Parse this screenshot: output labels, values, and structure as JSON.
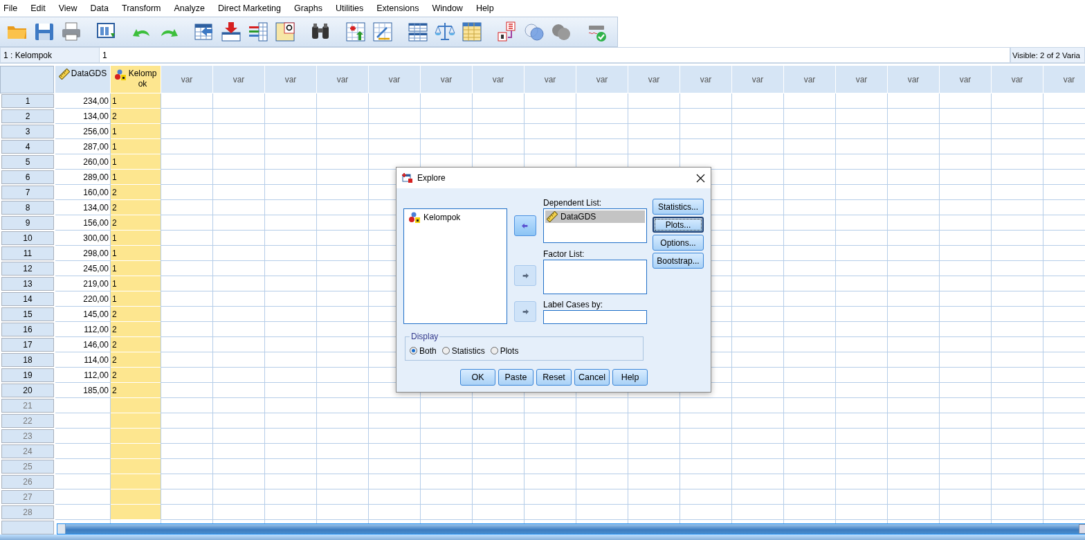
{
  "menu": [
    {
      "label": "File"
    },
    {
      "label": "Edit"
    },
    {
      "label": "View"
    },
    {
      "label": "Data"
    },
    {
      "label": "Transform"
    },
    {
      "label": "Analyze"
    },
    {
      "label": "Direct Marketing"
    },
    {
      "label": "Graphs"
    },
    {
      "label": "Utilities"
    },
    {
      "label": "Extensions"
    },
    {
      "label": "Window"
    },
    {
      "label": "Help"
    }
  ],
  "cell_editor": {
    "cell": "1 : Kelompok",
    "value": "1",
    "visible": "Visible: 2 of 2 Varia"
  },
  "grid": {
    "columns": [
      {
        "label": "DataGDS",
        "kind": "scale",
        "selected": false
      },
      {
        "label": "Kelompok",
        "kind": "nominal",
        "selected": true
      },
      {
        "label": "var",
        "kind": "empty",
        "selected": false
      },
      {
        "label": "var",
        "kind": "empty",
        "selected": false
      },
      {
        "label": "var",
        "kind": "empty",
        "selected": false
      },
      {
        "label": "var",
        "kind": "empty",
        "selected": false
      },
      {
        "label": "var",
        "kind": "empty",
        "selected": false
      },
      {
        "label": "var",
        "kind": "empty",
        "selected": false
      },
      {
        "label": "var",
        "kind": "empty",
        "selected": false
      },
      {
        "label": "var",
        "kind": "empty",
        "selected": false
      },
      {
        "label": "var",
        "kind": "empty",
        "selected": false
      },
      {
        "label": "var",
        "kind": "empty",
        "selected": false
      },
      {
        "label": "var",
        "kind": "empty",
        "selected": false
      },
      {
        "label": "var",
        "kind": "empty",
        "selected": false
      },
      {
        "label": "var",
        "kind": "empty",
        "selected": false
      },
      {
        "label": "var",
        "kind": "empty",
        "selected": false
      },
      {
        "label": "var",
        "kind": "empty",
        "selected": false
      },
      {
        "label": "var",
        "kind": "empty",
        "selected": false
      },
      {
        "label": "var",
        "kind": "empty",
        "selected": false
      },
      {
        "label": "var",
        "kind": "empty",
        "selected": false
      }
    ],
    "rows": [
      {
        "number": "1",
        "filled": true,
        "cells": [
          "234,00",
          "1"
        ]
      },
      {
        "number": "2",
        "filled": true,
        "cells": [
          "134,00",
          "2"
        ]
      },
      {
        "number": "3",
        "filled": true,
        "cells": [
          "256,00",
          "1"
        ]
      },
      {
        "number": "4",
        "filled": true,
        "cells": [
          "287,00",
          "1"
        ]
      },
      {
        "number": "5",
        "filled": true,
        "cells": [
          "260,00",
          "1"
        ]
      },
      {
        "number": "6",
        "filled": true,
        "cells": [
          "289,00",
          "1"
        ]
      },
      {
        "number": "7",
        "filled": true,
        "cells": [
          "160,00",
          "2"
        ]
      },
      {
        "number": "8",
        "filled": true,
        "cells": [
          "134,00",
          "2"
        ]
      },
      {
        "number": "9",
        "filled": true,
        "cells": [
          "156,00",
          "2"
        ]
      },
      {
        "number": "10",
        "filled": true,
        "cells": [
          "300,00",
          "1"
        ]
      },
      {
        "number": "11",
        "filled": true,
        "cells": [
          "298,00",
          "1"
        ]
      },
      {
        "number": "12",
        "filled": true,
        "cells": [
          "245,00",
          "1"
        ]
      },
      {
        "number": "13",
        "filled": true,
        "cells": [
          "219,00",
          "1"
        ]
      },
      {
        "number": "14",
        "filled": true,
        "cells": [
          "220,00",
          "1"
        ]
      },
      {
        "number": "15",
        "filled": true,
        "cells": [
          "145,00",
          "2"
        ]
      },
      {
        "number": "16",
        "filled": true,
        "cells": [
          "112,00",
          "2"
        ]
      },
      {
        "number": "17",
        "filled": true,
        "cells": [
          "146,00",
          "2"
        ]
      },
      {
        "number": "18",
        "filled": true,
        "cells": [
          "114,00",
          "2"
        ]
      },
      {
        "number": "19",
        "filled": true,
        "cells": [
          "112,00",
          "2"
        ]
      },
      {
        "number": "20",
        "filled": true,
        "cells": [
          "185,00",
          "2"
        ]
      },
      {
        "number": "21",
        "filled": false
      },
      {
        "number": "22",
        "filled": false
      },
      {
        "number": "23",
        "filled": false
      },
      {
        "number": "24",
        "filled": false
      },
      {
        "number": "25",
        "filled": false
      },
      {
        "number": "26",
        "filled": false
      },
      {
        "number": "27",
        "filled": false
      },
      {
        "number": "28",
        "filled": false
      }
    ]
  },
  "dialog": {
    "title": "Explore",
    "source_list": [
      {
        "label": "Kelompok",
        "kind": "nominal"
      }
    ],
    "move_buttons": [
      {
        "disabled": false
      },
      {
        "disabled": true
      },
      {
        "disabled": true
      }
    ],
    "dependent_list": {
      "label": "Dependent List:",
      "items": [
        {
          "label": "DataGDS",
          "kind": "scale",
          "selected": true
        }
      ]
    },
    "factor_list": {
      "label": "Factor List:"
    },
    "label_cases": {
      "label": "Label Cases by:"
    },
    "side_buttons": [
      {
        "label": "Statistics...",
        "focused": false
      },
      {
        "label": "Plots...",
        "focused": true
      },
      {
        "label": "Options...",
        "focused": false
      },
      {
        "label": "Bootstrap...",
        "focused": false
      }
    ],
    "display": {
      "label": "Display",
      "options": [
        {
          "label": "Both",
          "selected": true
        },
        {
          "label": "Statistics",
          "selected": false
        },
        {
          "label": "Plots",
          "selected": false
        }
      ]
    },
    "buttons": [
      {
        "label": "OK"
      },
      {
        "label": "Paste"
      },
      {
        "label": "Reset"
      },
      {
        "label": "Cancel"
      },
      {
        "label": "Help"
      }
    ]
  }
}
